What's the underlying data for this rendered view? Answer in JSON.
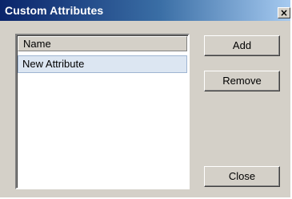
{
  "window": {
    "title": "Custom Attributes",
    "close_glyph": "×"
  },
  "list": {
    "column_header": "Name",
    "items": [
      {
        "label": "New Attribute"
      }
    ]
  },
  "buttons": {
    "add_label": "Add",
    "remove_label": "Remove",
    "close_label": "Close"
  },
  "colors": {
    "titlebar_start": "#0a246a",
    "titlebar_end": "#a6caf0",
    "dialog_face": "#d4d0c8",
    "row_highlight": "#dce6f2"
  }
}
